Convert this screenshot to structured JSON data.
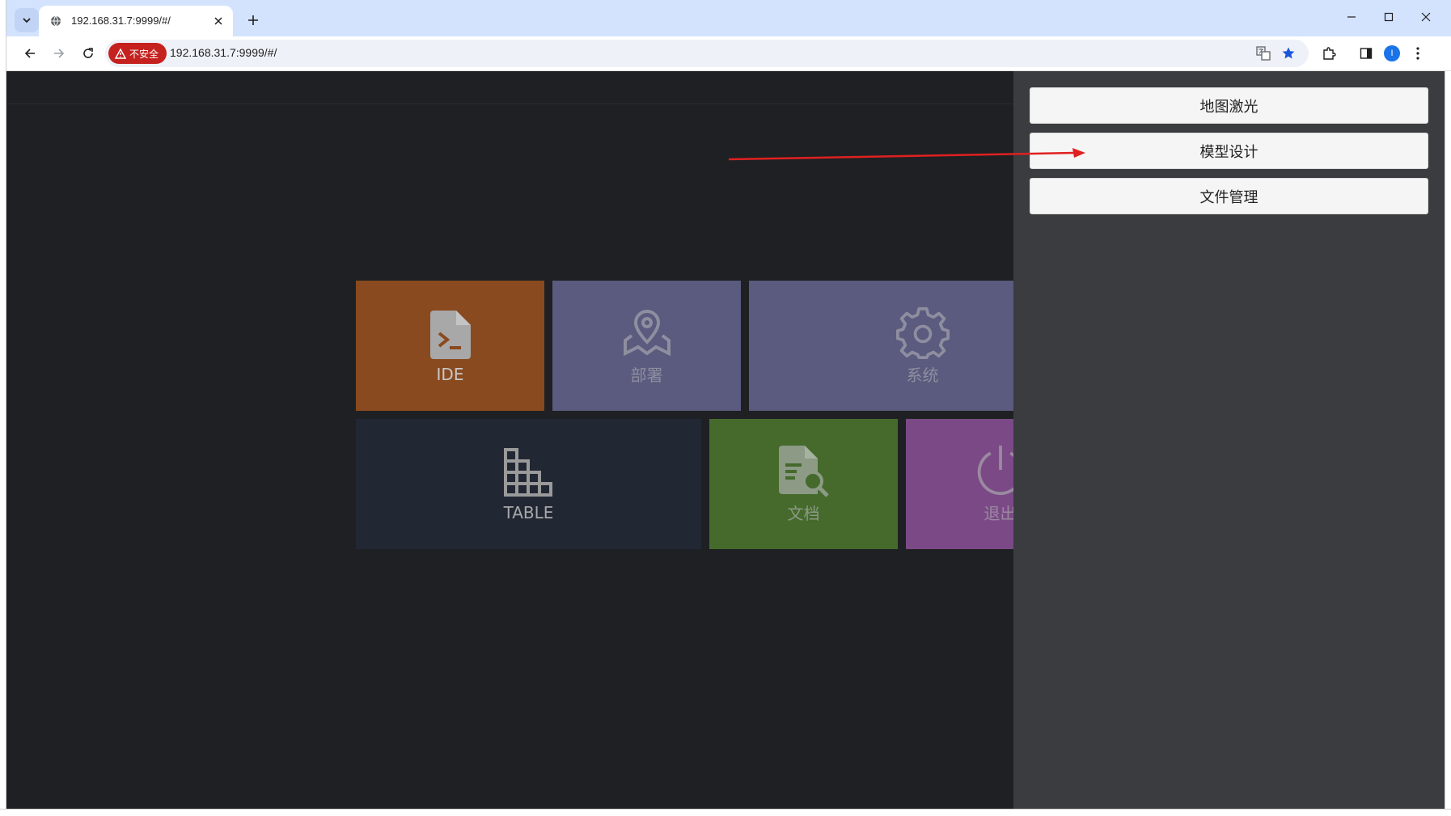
{
  "browser": {
    "tab_title": "192.168.31.7:9999/#/",
    "security_label": "不安全",
    "url": "192.168.31.7:9999/#/",
    "profile_initial": "I"
  },
  "tiles": [
    {
      "id": "ide",
      "label": "IDE",
      "icon": "terminal-file-icon",
      "color": "#8a4a1f",
      "label_color": "#c8c8c8"
    },
    {
      "id": "deploy",
      "label": "部署",
      "icon": "map-pin-icon",
      "color": "#5a5b7e",
      "label_color": "#8e8ea0"
    },
    {
      "id": "system",
      "label": "系统",
      "icon": "gear-icon",
      "color": "#5a5b7e",
      "label_color": "#8e8ea0"
    },
    {
      "id": "table",
      "label": "TABLE",
      "icon": "blocks-icon",
      "color": "#222734",
      "label_color": "#a8a8a8"
    },
    {
      "id": "docs",
      "label": "文档",
      "icon": "document-search-icon",
      "color": "#456a2c",
      "label_color": "#8c9a86"
    },
    {
      "id": "logout",
      "label": "退出",
      "icon": "power-icon",
      "color": "#7b4a86",
      "label_color": "#9a8aa0"
    }
  ],
  "drawer": {
    "buttons": [
      "地图激光",
      "模型设计",
      "文件管理"
    ]
  },
  "colors": {
    "page_bg": "#1f2023",
    "drawer_bg": "#3a3c3f",
    "annotation_arrow": "#e02020"
  }
}
